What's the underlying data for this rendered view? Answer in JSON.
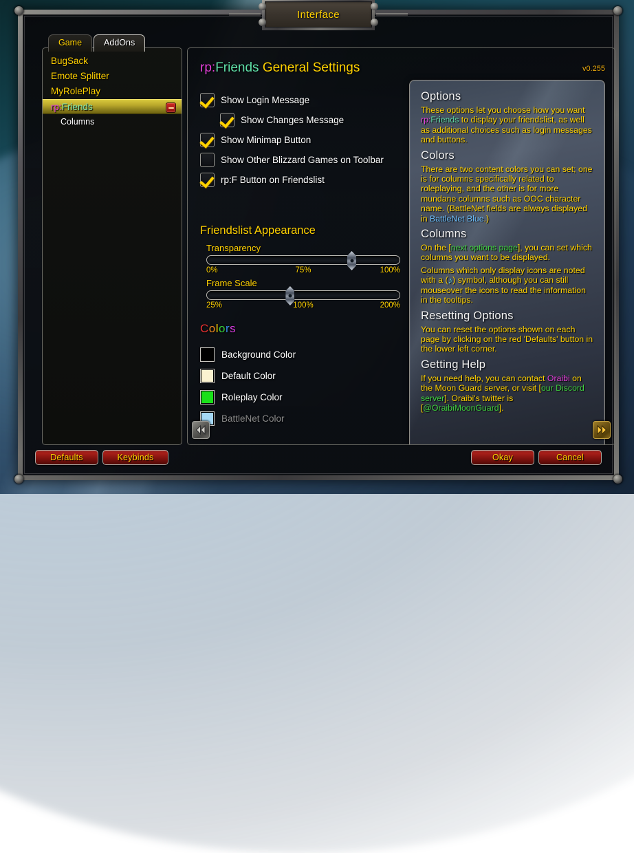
{
  "window": {
    "title": "Interface"
  },
  "tabs": [
    {
      "label": "Game",
      "active": false
    },
    {
      "label": "AddOns",
      "active": true
    }
  ],
  "addon_list": [
    {
      "label": "BugSack",
      "selected": false,
      "child": false
    },
    {
      "label": "Emote Splitter",
      "selected": false,
      "child": false
    },
    {
      "label": "MyRolePlay",
      "selected": false,
      "child": false
    },
    {
      "label": "rp:Friends",
      "label_prefix": "rp:",
      "label_suffix": "Friends",
      "selected": true,
      "child": false,
      "collapse_icon": "minus-icon"
    },
    {
      "label": "Columns",
      "selected": false,
      "child": true
    }
  ],
  "panel": {
    "title_prefix": "rp:",
    "title_name": "Friends",
    "title_rest": " General Settings",
    "version": "v0.255"
  },
  "checkboxes": [
    {
      "label": "Show Login Message",
      "checked": true,
      "indent": false
    },
    {
      "label": "Show Changes Message",
      "checked": true,
      "indent": true
    },
    {
      "label": "Show Minimap Button",
      "checked": true,
      "indent": false
    },
    {
      "label": "Show Other Blizzard Games on Toolbar",
      "checked": false,
      "indent": false
    },
    {
      "label": "rp:F Button on Friendslist",
      "checked": true,
      "indent": false
    }
  ],
  "appearance": {
    "heading": "Friendslist Appearance",
    "sliders": [
      {
        "label": "Transparency",
        "min_label": "0%",
        "mid_label": "75%",
        "max_label": "100%",
        "value_percent": 75
      },
      {
        "label": "Frame Scale",
        "min_label": "25%",
        "mid_label": "100%",
        "max_label": "200%",
        "value_percent": 43
      }
    ]
  },
  "colors_section": {
    "heading_letters": [
      {
        "ch": "C",
        "color": "#e83030"
      },
      {
        "ch": "o",
        "color": "#f08a1e"
      },
      {
        "ch": "l",
        "color": "#ffd100"
      },
      {
        "ch": "o",
        "color": "#36d13a"
      },
      {
        "ch": "r",
        "color": "#3a8ce8"
      },
      {
        "ch": "s",
        "color": "#d93ce0"
      }
    ],
    "swatches": [
      {
        "label": "Background Color",
        "color": "#000000",
        "disabled": false
      },
      {
        "label": "Default Color",
        "color": "#fbf2d0",
        "disabled": false
      },
      {
        "label": "Roleplay Color",
        "color": "#1ae01a",
        "disabled": false
      },
      {
        "label": "BattleNet Color",
        "color": "#a5d8f5",
        "disabled": true
      }
    ]
  },
  "info_panel": {
    "sections": [
      {
        "heading": "Options",
        "paragraphs": [
          {
            "parts": [
              {
                "t": "These options let you choose how you want "
              },
              {
                "t": "rp:",
                "c": "rp"
              },
              {
                "t": "Friends",
                "c": "name"
              },
              {
                "t": " to display your friendslist, as well as additional choices such as login messages and buttons."
              }
            ]
          }
        ]
      },
      {
        "heading": "Colors",
        "paragraphs": [
          {
            "parts": [
              {
                "t": "There are two content colors you can set; one is for columns specifically related to roleplaying, and the other is for more mundane columns such as OOC character name. (BattleNet fields are always displayed in "
              },
              {
                "t": "BattleNet Blue",
                "c": "blue"
              },
              {
                "t": ".)"
              }
            ]
          }
        ]
      },
      {
        "heading": "Columns",
        "paragraphs": [
          {
            "parts": [
              {
                "t": "On the ["
              },
              {
                "t": "next options page",
                "c": "green"
              },
              {
                "t": "], you can set which columns you want to be displayed."
              }
            ]
          },
          {
            "parts": [
              {
                "t": "Columns which only display icons are noted with a ("
              },
              {
                "t": "♪",
                "c": "glyph"
              },
              {
                "t": ") symbol, although you can still mouseover the icons to read the information in the tooltips."
              }
            ]
          }
        ]
      },
      {
        "heading": "Resetting Options",
        "paragraphs": [
          {
            "parts": [
              {
                "t": "You can reset the options shown on each page by clicking on the red 'Defaults' button in the lower left corner."
              }
            ]
          }
        ]
      },
      {
        "heading": "Getting Help",
        "paragraphs": [
          {
            "parts": [
              {
                "t": "If you need help, you can contact "
              },
              {
                "t": "Oraibi",
                "c": "pink"
              },
              {
                "t": " on the Moon Guard server, or visit ["
              },
              {
                "t": "our Discord server",
                "c": "green"
              },
              {
                "t": "]. Oraibi's twitter is ["
              },
              {
                "t": "@OraibiMoonGuard",
                "c": "green"
              },
              {
                "t": "]."
              }
            ]
          }
        ]
      }
    ]
  },
  "nav": {
    "prev_icon": "double-chevron-left-icon",
    "next_icon": "double-chevron-right-icon",
    "prev_enabled": false,
    "next_enabled": true
  },
  "footer_buttons": {
    "defaults": "Defaults",
    "keybinds": "Keybinds",
    "okay": "Okay",
    "cancel": "Cancel"
  }
}
